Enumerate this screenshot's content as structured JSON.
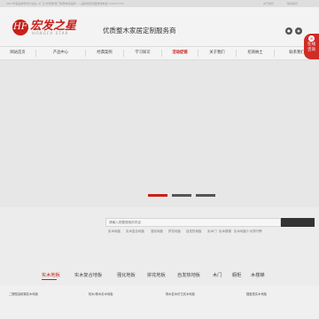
{
  "topbar": {
    "notice": "2017年度品牌影响力企业, 4门上市家居/厦门家居电商品牌——品牌招商加盟热线电话: 0447/7770",
    "links": [
      "关于我们",
      "联系我们"
    ]
  },
  "header": {
    "logo_mark": "HF",
    "logo_cn": "宏发之星",
    "logo_en": "HONGFA STAR",
    "slogan": "优质整木家居定制服务商",
    "icons": [
      "wechat-icon",
      "weibo-icon"
    ]
  },
  "nav": {
    "items": [
      "网站首页",
      "产品中心",
      "经典案例",
      "学习知识",
      "活动促销",
      "关于我们",
      "招商纳士",
      "联系我们"
    ],
    "active_index": 4
  },
  "side_tab": {
    "label_line1": "在线",
    "label_line2": "咨询"
  },
  "banner": {
    "dots": 3,
    "active_dot": 0
  },
  "search": {
    "placeholder": "请输入您要搜索的内容",
    "hot_keywords": [
      "实木地板",
      "实木复合地板",
      "强化地板",
      "拼花地板",
      "自发热地板",
      "实木门",
      "实木楼梯",
      "实木地板十大排行榜"
    ]
  },
  "categories": {
    "items": [
      "实木地板",
      "实木复合地板",
      "强化地板",
      "拼花地板",
      "自发热地板",
      "木门",
      "橱柜",
      "木楼梯"
    ],
    "active_index": 0
  },
  "products": [
    "二棚型高耐磨实木地板",
    "柏木/橡木实木地板",
    "橡木复木仿古实木地板",
    "圆盘型实木地板"
  ],
  "colors": {
    "brand_red": "#c8201b",
    "dark": "#333333",
    "muted": "#999999"
  }
}
